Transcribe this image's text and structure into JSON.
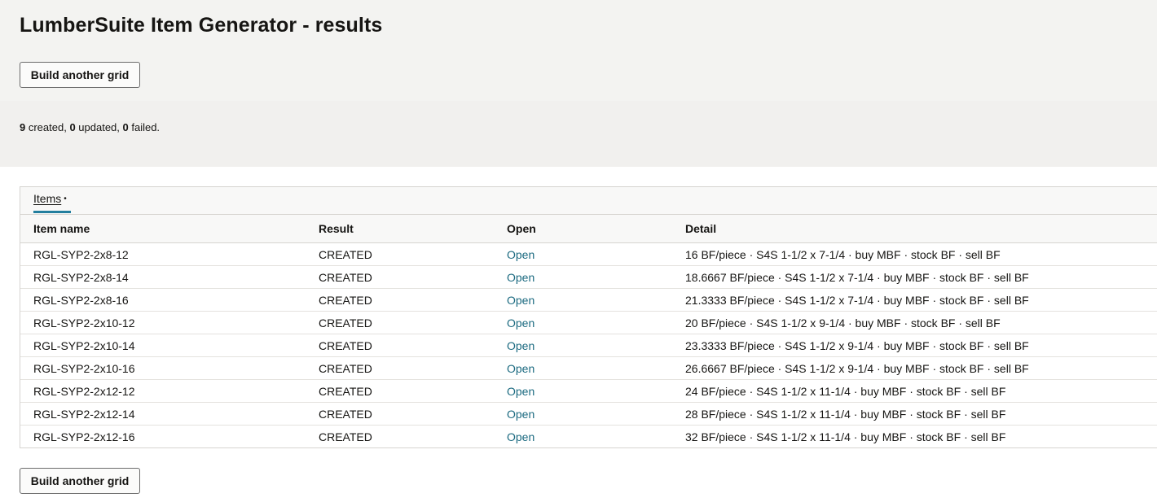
{
  "page": {
    "title": "LumberSuite Item Generator - results",
    "build_button_label": "Build another grid"
  },
  "summary": {
    "created_count": "9",
    "created_label": " created, ",
    "updated_count": "0",
    "updated_label": " updated, ",
    "failed_count": "0",
    "failed_label": " failed."
  },
  "tabs": [
    {
      "label": "Items",
      "active": true,
      "indicator": "•"
    }
  ],
  "table": {
    "columns": [
      "Item name",
      "Result",
      "Open",
      "Detail"
    ],
    "rows": [
      {
        "name": "RGL-SYP2-2x8-12",
        "result": "CREATED",
        "open": "Open",
        "detail": "16 BF/piece · S4S 1-1/2 x 7-1/4 · buy MBF · stock BF · sell BF"
      },
      {
        "name": "RGL-SYP2-2x8-14",
        "result": "CREATED",
        "open": "Open",
        "detail": "18.6667 BF/piece · S4S 1-1/2 x 7-1/4 · buy MBF · stock BF · sell BF"
      },
      {
        "name": "RGL-SYP2-2x8-16",
        "result": "CREATED",
        "open": "Open",
        "detail": "21.3333 BF/piece · S4S 1-1/2 x 7-1/4 · buy MBF · stock BF · sell BF"
      },
      {
        "name": "RGL-SYP2-2x10-12",
        "result": "CREATED",
        "open": "Open",
        "detail": "20 BF/piece · S4S 1-1/2 x 9-1/4 · buy MBF · stock BF · sell BF"
      },
      {
        "name": "RGL-SYP2-2x10-14",
        "result": "CREATED",
        "open": "Open",
        "detail": "23.3333 BF/piece · S4S 1-1/2 x 9-1/4 · buy MBF · stock BF · sell BF"
      },
      {
        "name": "RGL-SYP2-2x10-16",
        "result": "CREATED",
        "open": "Open",
        "detail": "26.6667 BF/piece · S4S 1-1/2 x 9-1/4 · buy MBF · stock BF · sell BF"
      },
      {
        "name": "RGL-SYP2-2x12-12",
        "result": "CREATED",
        "open": "Open",
        "detail": "24 BF/piece · S4S 1-1/2 x 11-1/4 · buy MBF · stock BF · sell BF"
      },
      {
        "name": "RGL-SYP2-2x12-14",
        "result": "CREATED",
        "open": "Open",
        "detail": "28 BF/piece · S4S 1-1/2 x 11-1/4 · buy MBF · stock BF · sell BF"
      },
      {
        "name": "RGL-SYP2-2x12-16",
        "result": "CREATED",
        "open": "Open",
        "detail": "32 BF/piece · S4S 1-1/2 x 11-1/4 · buy MBF · stock BF · sell BF"
      }
    ]
  },
  "colors": {
    "header_bg": "#f3f3f1",
    "link": "#1b6a80",
    "tab_accent": "#227e9e"
  }
}
